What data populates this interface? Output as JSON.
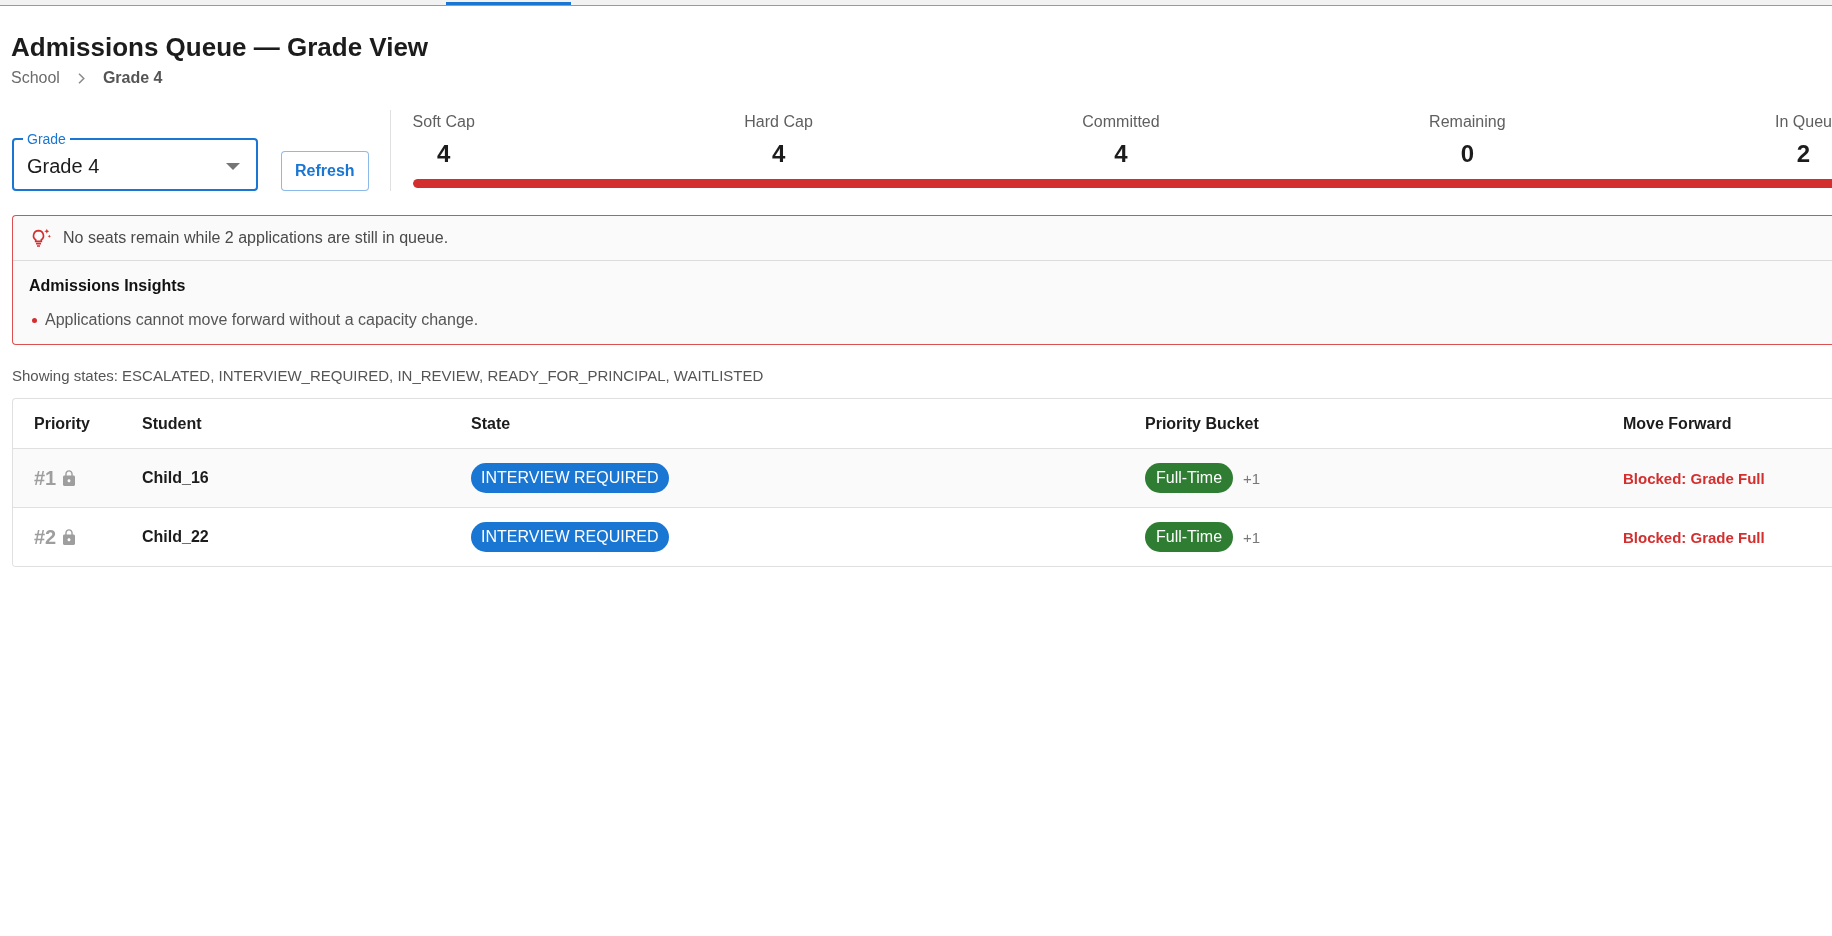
{
  "page": {
    "title": "Admissions Queue — Grade View",
    "breadcrumb": [
      {
        "label": "School",
        "current": false
      },
      {
        "label": "Grade 4",
        "current": true
      }
    ]
  },
  "controls": {
    "grade_select": {
      "label": "Grade",
      "value": "Grade 4"
    },
    "refresh_button": "Refresh"
  },
  "metrics": [
    {
      "label": "Soft Cap",
      "value": "4"
    },
    {
      "label": "Hard Cap",
      "value": "4"
    },
    {
      "label": "Committed",
      "value": "4"
    },
    {
      "label": "Remaining",
      "value": "0"
    },
    {
      "label": "In Queu",
      "value": "2"
    }
  ],
  "capacity_bar": {
    "level": 1
  },
  "alert": {
    "message": "No seats remain while 2 applications are still in queue.",
    "title": "Admissions Insights",
    "items": [
      "Applications cannot move forward without a capacity change."
    ]
  },
  "filter_summary": "Showing states: ESCALATED, INTERVIEW_REQUIRED, IN_REVIEW, READY_FOR_PRINCIPAL, WAITLISTED",
  "table": {
    "columns": [
      "Priority",
      "Student",
      "State",
      "Priority Bucket",
      "Move Forward"
    ],
    "rows": [
      {
        "priority": "#1",
        "locked": true,
        "student": "Child_16",
        "state": "INTERVIEW REQUIRED",
        "bucket": "Full-Time",
        "bucket_extra": "+1",
        "move_forward": "Blocked: Grade Full"
      },
      {
        "priority": "#2",
        "locked": true,
        "student": "Child_22",
        "state": "INTERVIEW REQUIRED",
        "bucket": "Full-Time",
        "bucket_extra": "+1",
        "move_forward": "Blocked: Grade Full"
      }
    ]
  }
}
